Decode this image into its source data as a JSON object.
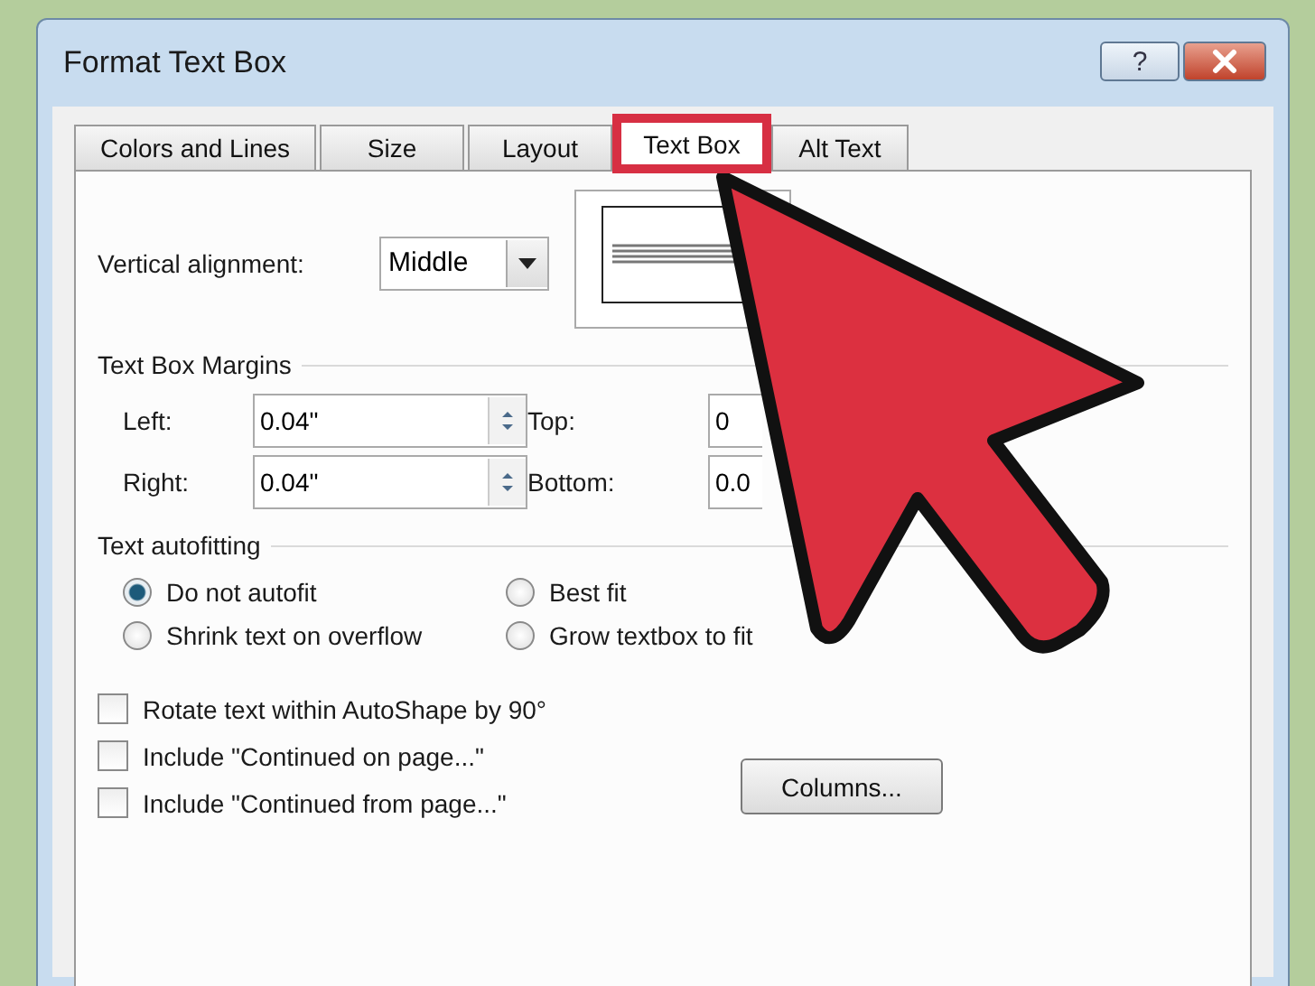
{
  "window": {
    "title": "Format Text Box",
    "help_label": "?"
  },
  "tabs": [
    {
      "label": "Colors and Lines",
      "selected": false
    },
    {
      "label": "Size",
      "selected": false
    },
    {
      "label": "Layout",
      "selected": false
    },
    {
      "label": "Text Box",
      "selected": true
    },
    {
      "label": "Alt Text",
      "selected": false
    }
  ],
  "vertical_alignment": {
    "label": "Vertical alignment:",
    "value": "Middle"
  },
  "margins": {
    "title": "Text Box Margins",
    "fields": [
      {
        "label": "Left:",
        "value": "0.04\""
      },
      {
        "label": "Top:",
        "value": "0"
      },
      {
        "label": "Right:",
        "value": "0.04\""
      },
      {
        "label": "Bottom:",
        "value": "0.0"
      }
    ]
  },
  "autofitting": {
    "title": "Text autofitting",
    "options": [
      {
        "label": "Do not autofit",
        "selected": true
      },
      {
        "label": "Best fit",
        "selected": false
      },
      {
        "label": "Shrink text on overflow",
        "selected": false
      },
      {
        "label": "Grow textbox to fit",
        "selected": false
      }
    ]
  },
  "checkboxes": [
    {
      "label": "Rotate text within AutoShape by 90°",
      "checked": false
    },
    {
      "label": "Include \"Continued on page...\"",
      "checked": false
    },
    {
      "label": "Include \"Continued from page...\"",
      "checked": false
    }
  ],
  "columns_button": "Columns..."
}
